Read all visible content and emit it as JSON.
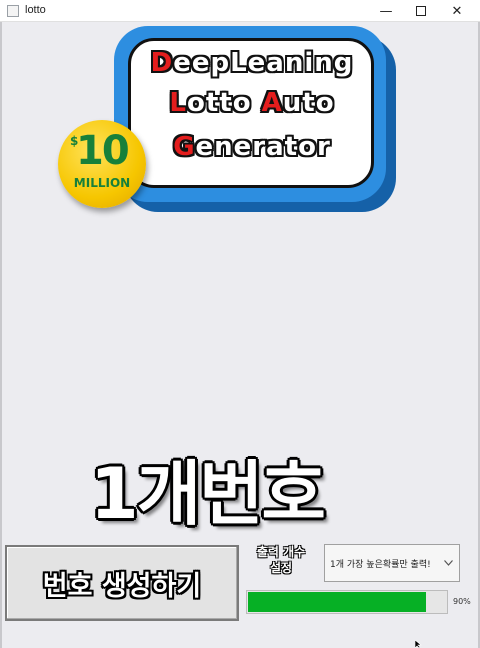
{
  "window": {
    "title": "lotto",
    "minimize_glyph": "—",
    "close_glyph": "✕"
  },
  "logo": {
    "line1_first": "D",
    "line1_rest": "eepLeaning",
    "line2_first": "L",
    "line2_mid": "otto ",
    "line2_red": "A",
    "line2_rest": "uto",
    "line3_first": "G",
    "line3_rest": "enerator",
    "coin_symbol": "$",
    "coin_number": "10",
    "coin_text": "MILLION",
    "colors": {
      "red": "#e41d1d",
      "blue": "#2d8ee0",
      "coin": "#f6c600",
      "coin_text": "#17803a"
    }
  },
  "result": {
    "text": "1개번호"
  },
  "controls": {
    "generate_label": "번호 생성하기",
    "count_label_line1": "출력 개수",
    "count_label_line2": "설정",
    "count_select_value": "1개 가장 높은확률만 출력!",
    "progress_percent": 90,
    "progress_text": "90%",
    "progress_color": "#06b025"
  }
}
